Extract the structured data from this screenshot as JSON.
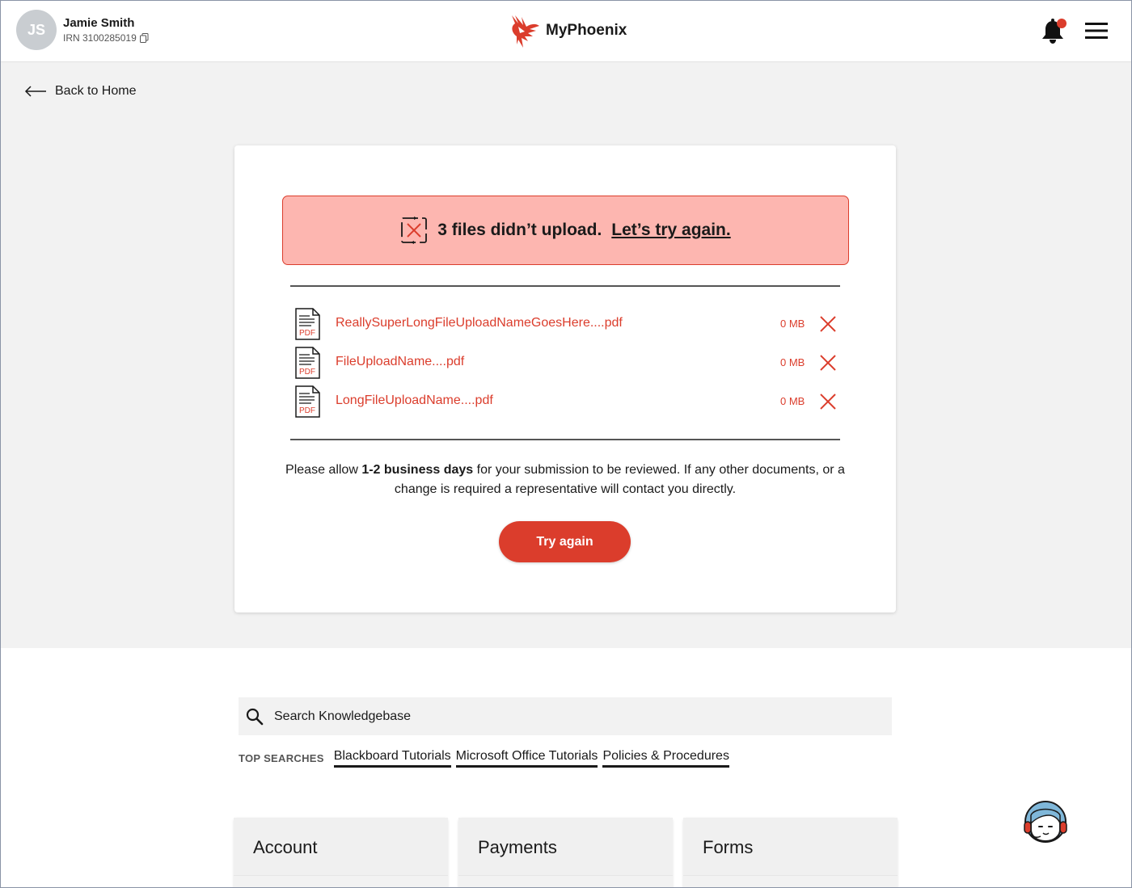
{
  "header": {
    "avatar_initials": "JS",
    "user_name": "Jamie Smith",
    "irn": "IRN 3100285019",
    "brand_name": "MyPhoenix",
    "notification_dot_color": "#db3d2c"
  },
  "nav": {
    "back_label": "Back to Home"
  },
  "upload": {
    "alert_text": "3 files didn’t upload.",
    "alert_link": "Let’s try again.",
    "files": [
      {
        "name": "ReallySuperLongFileUploadNameGoesHere....pdf",
        "size": "0 MB",
        "icon_label": "PDF"
      },
      {
        "name": "FileUploadName....pdf",
        "size": "0 MB",
        "icon_label": "PDF"
      },
      {
        "name": "LongFileUploadName....pdf",
        "size": "0 MB",
        "icon_label": "PDF"
      }
    ],
    "note_prefix": "Please allow ",
    "note_bold": "1-2 business days",
    "note_suffix": " for your submission to be reviewed. If any other documents, or a change is required a representative will contact you directly.",
    "try_again_label": "Try again"
  },
  "knowledgebase": {
    "search_placeholder": "Search Knowledgebase",
    "top_searches_label": "TOP SEARCHES",
    "top_searches": [
      "Blackboard Tutorials",
      "Microsoft Office Tutorials",
      "Policies & Procedures"
    ]
  },
  "tiles": [
    "Account",
    "Payments",
    "Forms"
  ],
  "colors": {
    "accent": "#db3d2c",
    "alert_bg": "#fdb6b0",
    "page_bg": "#f2f2f2"
  }
}
